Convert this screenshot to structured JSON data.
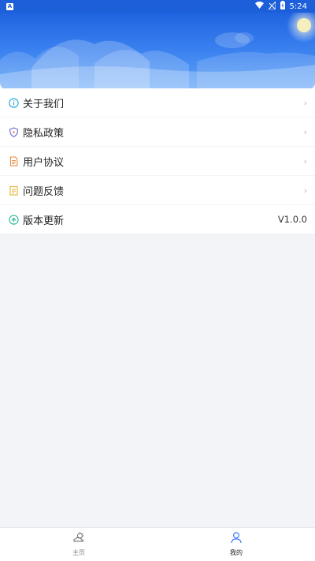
{
  "status_bar": {
    "app_badge": "A",
    "time": "5:24",
    "wifi_icon": "wifi-icon",
    "signal_icon": "no-signal-icon",
    "battery_icon": "battery-charging-icon"
  },
  "menu": {
    "items": [
      {
        "label": "关于我们",
        "icon": "info-icon",
        "color": "#1aa1d9",
        "trailing": "›"
      },
      {
        "label": "隐私政策",
        "icon": "shield-icon",
        "color": "#6b6bd6",
        "trailing": "›"
      },
      {
        "label": "用户协议",
        "icon": "document-icon",
        "color": "#e58a3e",
        "trailing": "›"
      },
      {
        "label": "问题反馈",
        "icon": "feedback-icon",
        "color": "#e5b43a",
        "trailing": "›"
      },
      {
        "label": "版本更新",
        "icon": "update-icon",
        "color": "#2bb59a",
        "trailing": "V1.0.0"
      }
    ]
  },
  "tab_bar": {
    "tabs": [
      {
        "label": "主页",
        "icon": "weather-home-icon",
        "active": false
      },
      {
        "label": "我的",
        "icon": "person-icon",
        "active": true,
        "color": "#3b7ff5"
      }
    ]
  }
}
